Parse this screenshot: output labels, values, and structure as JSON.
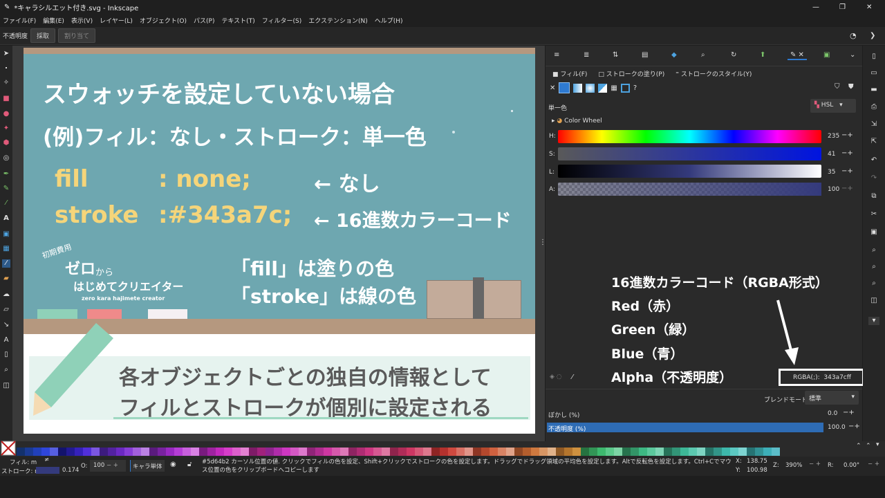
{
  "window": {
    "title": "*キャラシルエット付き.svg - Inkscape"
  },
  "menu": [
    "ファイル(F)",
    "編集(E)",
    "表示(V)",
    "レイヤー(L)",
    "オブジェクト(O)",
    "パス(P)",
    "テキスト(T)",
    "フィルター(S)",
    "エクステンション(N)",
    "ヘルプ(H)"
  ],
  "toolctl": {
    "label": "不透明度",
    "btn1": "採取",
    "btn2": "割り当て"
  },
  "artboard": {
    "heading1": "スウォッチを設定していない場合",
    "heading2": "(例)フィル：なし・ストローク：単一色",
    "fill_key": "fill",
    "fill_val": ": none;",
    "fill_note": "← なし",
    "stroke_key": "stroke",
    "stroke_val": ":#343a7c;",
    "stroke_note": "← 16進数カラーコード",
    "note1": "「fill」は塗りの色",
    "note2": "「stroke」は線の色",
    "logo_small": "初期費用",
    "logo_main": "ゼロ",
    "logo_kara": "から",
    "logo_sub": "はじめてクリエイター",
    "logo_roman": "zero kara hajimete creator",
    "banner1": "各オブジェクトごとの独自の情報として",
    "banner2": "フィルとストロークが個別に設定される"
  },
  "panel": {
    "tab_fill": "フィル(F)",
    "tab_stroke_paint": "ストロークの塗り(P)",
    "tab_stroke_style": "ストロークのスタイル(Y)",
    "paint_type": "単一色",
    "mode": "HSL",
    "color_wheel": "Color Wheel",
    "sliders": [
      {
        "label": "H:",
        "value": "235"
      },
      {
        "label": "S:",
        "value": "41"
      },
      {
        "label": "L:",
        "value": "35"
      },
      {
        "label": "A:",
        "value": "100"
      }
    ],
    "overlay_title": "16進数カラーコード（RGBA形式）",
    "overlay_lines": [
      "Red（赤）",
      "Green（緑）",
      "Blue（青）",
      "Alpha（不透明度）"
    ],
    "rgba_label": "RGBA(;):",
    "rgba_value": "343a7cff",
    "blend_label": "ブレンドモード:",
    "blend_value": "標準",
    "blur_label": "ぼかし (%)",
    "blur_value": "0.0",
    "opacity_label": "不透明度 (%)",
    "opacity_value": "100.0"
  },
  "status": {
    "fill_label": "フィル: m",
    "stroke_label": "ストローク: m",
    "stroke_width": "0.174",
    "o_label": "O:",
    "o_value": "100",
    "layer": "キャラ単体",
    "message": "#5d64b2 カーソル位置の値. クリックでフィルの色を設定、Shift+クリックでストロークの色を設定します。ドラッグでドラッグ領域の平均色を設定します。Altで反転色を設定します。Ctrl+Cでマウス位置の色をクリップボードへコピーします",
    "x_label": "X:",
    "x": "138.75",
    "y_label": "Y:",
    "y": "100.98",
    "z_label": "Z:",
    "zoom": "390%",
    "r_label": "R:",
    "rot": "0.00°"
  },
  "colors": {
    "accent": "#2e7ad1",
    "stroke_color": "#343a7c",
    "artboard_bg": "#6ea7b0",
    "yellow": "#f5d57a"
  }
}
